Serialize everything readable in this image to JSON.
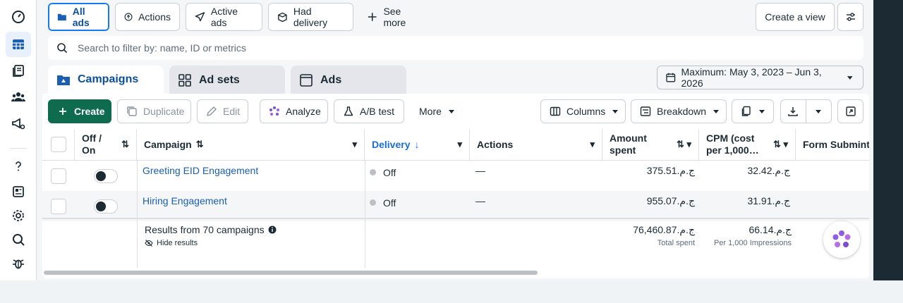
{
  "filters": {
    "all_ads": "All ads",
    "actions": "Actions",
    "active_ads": "Active ads",
    "had_delivery": "Had delivery",
    "see_more": "See more",
    "create_view": "Create a view"
  },
  "search": {
    "placeholder": "Search to filter by: name, ID or metrics"
  },
  "tabs": {
    "campaigns": "Campaigns",
    "ad_sets": "Ad sets",
    "ads": "Ads"
  },
  "date_range": "Maximum: May 3, 2023 – Jun 3, 2026",
  "toolbar": {
    "create": "Create",
    "duplicate": "Duplicate",
    "edit": "Edit",
    "analyze": "Analyze",
    "ab_test": "A/B test",
    "more": "More",
    "columns": "Columns",
    "breakdown": "Breakdown"
  },
  "table": {
    "headers": {
      "off_on": "Off / On",
      "campaign": "Campaign",
      "delivery": "Delivery",
      "actions": "Actions",
      "amount_spent": "Amount spent",
      "cpm": "CPM (cost per 1,000…",
      "form_submit": "Form Submint"
    },
    "rows": [
      {
        "campaign": "Greeting EID Engagement",
        "delivery": "Off",
        "actions": "—",
        "amount_spent": "ج.م.375.51",
        "cpm": "ج.م.32.42"
      },
      {
        "campaign": "Hiring Engagement",
        "delivery": "Off",
        "actions": "—",
        "amount_spent": "ج.م.955.07",
        "cpm": "ج.م.31.91"
      }
    ],
    "summary": {
      "results": "Results from 70 campaigns",
      "hide": "Hide results",
      "amount_spent": "ج.م.76,460.87",
      "amount_spent_sub": "Total spent",
      "cpm": "ج.م.66.14",
      "cpm_sub": "Per 1,000 Impressions"
    }
  },
  "colors": {
    "primary_green": "#0f6b4e",
    "link_blue": "#1a5fb4",
    "accent_blue": "#1877f2"
  }
}
